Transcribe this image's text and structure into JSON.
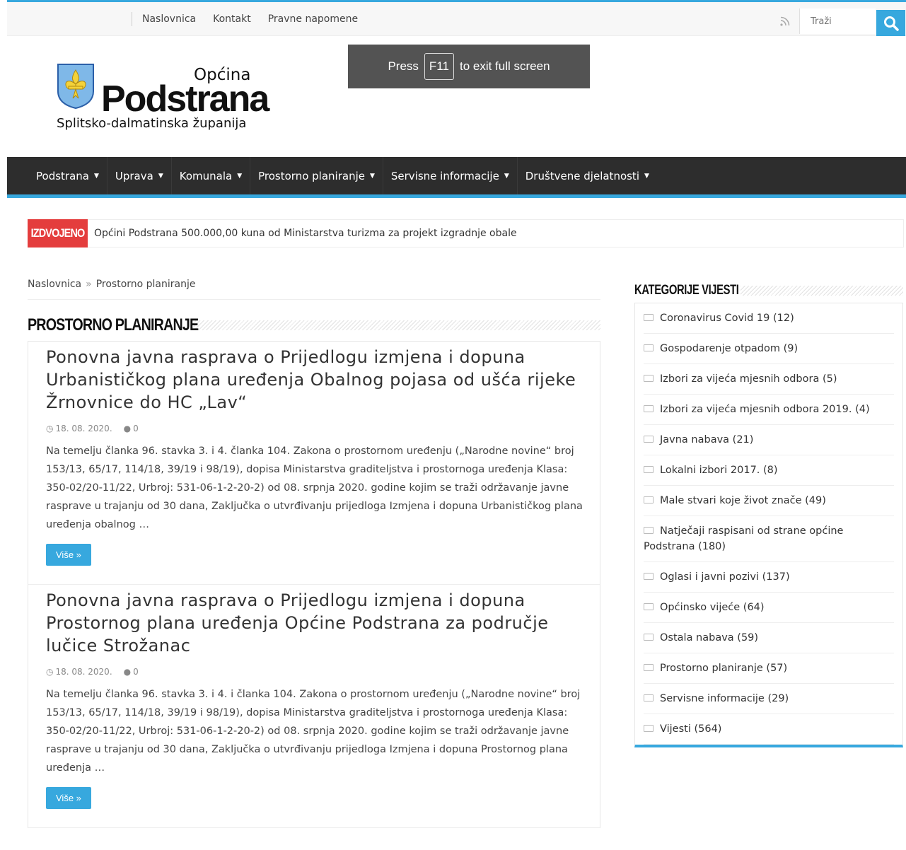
{
  "topbar": {
    "links": [
      "Naslovnica",
      "Kontakt",
      "Pravne napomene"
    ],
    "search_placeholder": "Traži"
  },
  "logo": {
    "line1": "Općina",
    "line2": "Podstrana",
    "line3": "Splitsko-dalmatinska županija"
  },
  "fullscreen_notice": {
    "before": "Press",
    "key": "F11",
    "after": "to exit full screen"
  },
  "mainnav": {
    "items": [
      "Podstrana",
      "Uprava",
      "Komunala",
      "Prostorno planiranje",
      "Servisne informacije",
      "Društvene djelatnosti"
    ]
  },
  "breaking": {
    "tag": "IZDVOJENO",
    "text": "Općini Podstrana 500.000,00 kuna od Ministarstva turizma za projekt izgradnje obale"
  },
  "breadcrumb": {
    "home": "Naslovnica",
    "sep": "»",
    "current": "Prostorno planiranje"
  },
  "page_title": "PROSTORNO PLANIRANJE",
  "posts": [
    {
      "title": "Ponovna javna rasprava o Prijedlogu izmjena i dopuna Urbanističkog plana uređenja Obalnog pojasa od ušća rijeke Žrnovnice do HC „Lav“",
      "date": "18. 08. 2020.",
      "comments": "0",
      "excerpt": "Na temelju članka 96. stavka 3. i 4. članka 104. Zakona o prostornom uređenju („Narodne novine“ broj 153/13, 65/17, 114/18, 39/19 i 98/19), dopisa Ministarstva graditeljstva i prostornoga uređenja Klasa: 350-02/20-11/22, Urbroj: 531-06-1-2-20-2) od 08. srpnja 2020. godine kojim se traži održavanje javne rasprave u trajanju od 30 dana, Zaključka o utvrđivanju prijedloga Izmjena i dopuna Urbanističkog plana uređenja obalnog …",
      "more": "Više »"
    },
    {
      "title": "Ponovna javna rasprava o Prijedlogu izmjena i dopuna Prostornog plana uređenja Općine Podstrana za područje lučice Strožanac",
      "date": "18. 08. 2020.",
      "comments": "0",
      "excerpt": "Na temelju članka 96. stavka 3. i 4. i članka 104. Zakona o prostornom uređenju („Narodne novine“ broj 153/13, 65/17, 114/18, 39/19 i 98/19), dopisa Ministarstva graditeljstva i prostornoga uređenja Klasa: 350-02/20-11/22, Urbroj: 531-06-1-2-20-2) od 08. srpnja 2020. godine kojim se traži održavanje javne rasprave u trajanju od 30 dana, Zaključka o utvrđivanju prijedloga Izmjena i dopuna Prostornog plana uređenja …",
      "more": "Više »"
    }
  ],
  "sidebar": {
    "title": "KATEGORIJE VIJESTI",
    "categories": [
      "Coronavirus Covid 19 (12)",
      "Gospodarenje otpadom (9)",
      "Izbori za vijeća mjesnih odbora (5)",
      "Izbori za vijeća mjesnih odbora 2019. (4)",
      "Javna nabava (21)",
      "Lokalni izbori 2017. (8)",
      "Male stvari koje život znače (49)",
      "Natječaji raspisani od strane općine Podstrana (180)",
      "Oglasi i javni pozivi (137)",
      "Općinsko vijeće (64)",
      "Ostala nabava (59)",
      "Prostorno planiranje (57)",
      "Servisne informacije (29)",
      "Vijesti (564)"
    ]
  },
  "colors": {
    "accent": "#37a8de",
    "nav_bg": "#2d2d2d",
    "breaking_tag": "#e43d3d"
  }
}
